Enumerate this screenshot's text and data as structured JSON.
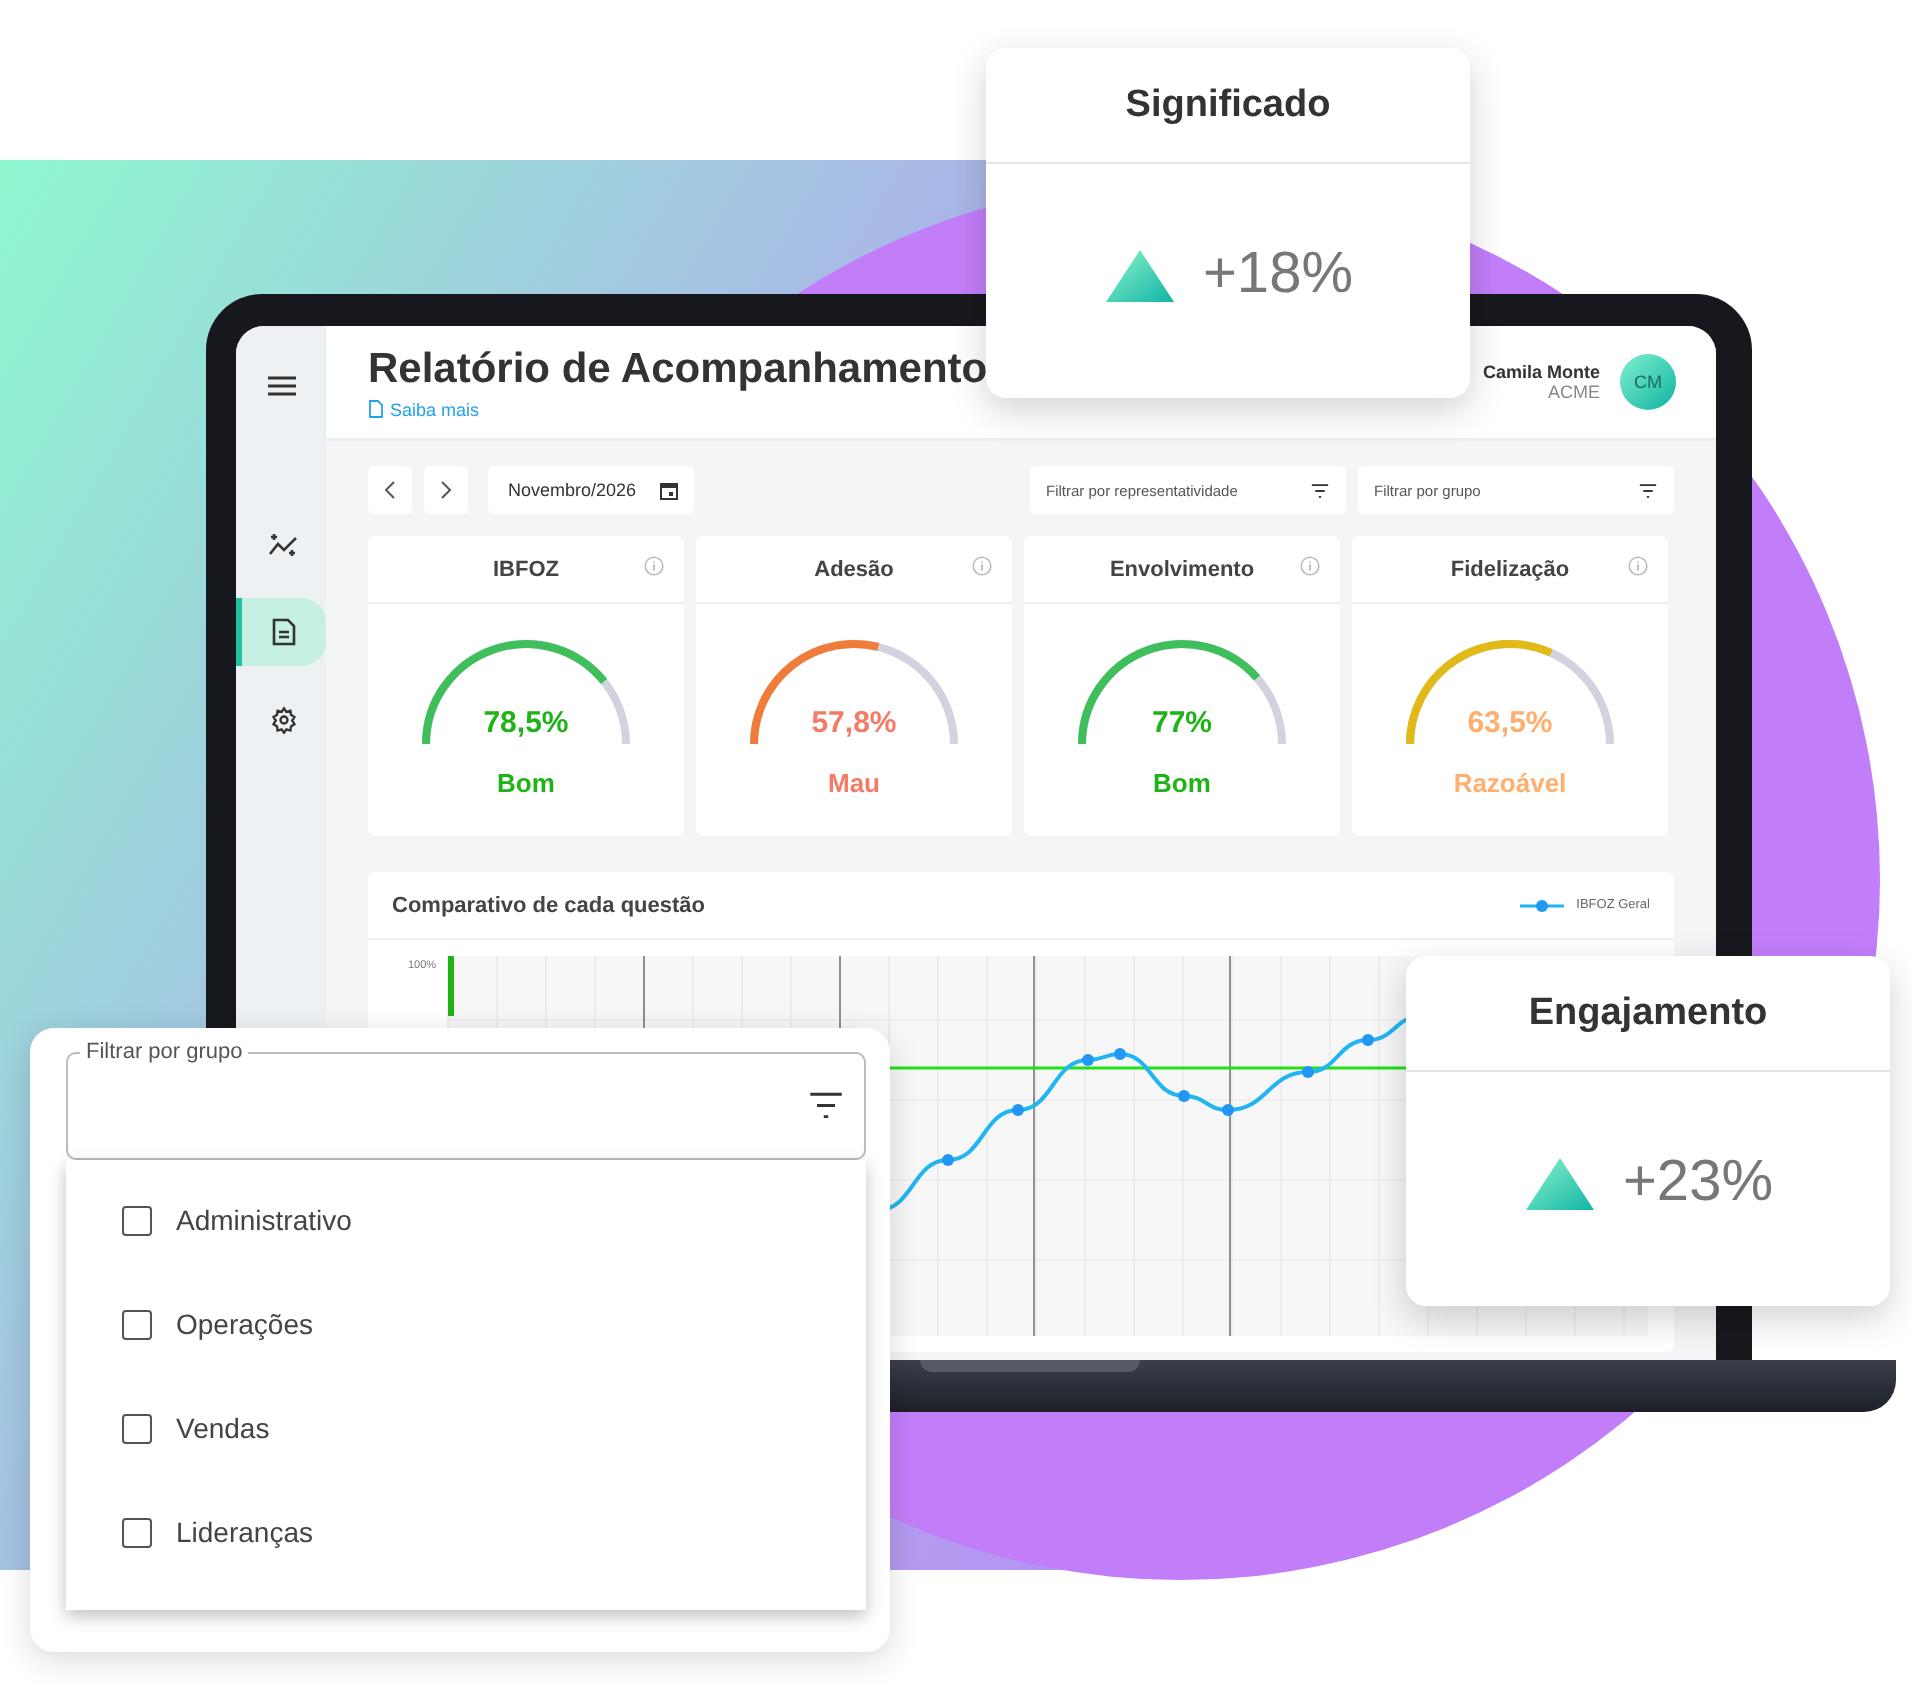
{
  "floating_cards": [
    {
      "title": "Significado",
      "change": "+18%"
    },
    {
      "title": "Engajamento",
      "change": "+23%"
    }
  ],
  "sidebar": {
    "items": [
      {
        "kind": "insights",
        "selected": false
      },
      {
        "kind": "report",
        "selected": true
      },
      {
        "kind": "settings",
        "selected": false
      }
    ]
  },
  "header": {
    "title": "Relatório de Acompanhamento",
    "link": "Saiba mais",
    "user": {
      "name": "Camila Monte",
      "company": "ACME",
      "initials": "CM"
    }
  },
  "toolbar": {
    "period": "Novembro/2026",
    "filters": [
      "Filtrar por representatividade",
      "Filtrar por grupo"
    ]
  },
  "metrics": [
    {
      "title": "IBFOZ",
      "value": "78,5%",
      "rating": {
        "text": "Bom",
        "color": "#1fb317"
      },
      "level": 0.785,
      "color": "#3fbf5c"
    },
    {
      "title": "Adesão",
      "value": "57,8%",
      "rating": {
        "text": "Mau",
        "color": "#f47c66"
      },
      "level": 0.578,
      "color": "#f07c3a"
    },
    {
      "title": "Envolvimento",
      "value": "77%",
      "rating": {
        "text": "Bom",
        "color": "#1fb317"
      },
      "level": 0.77,
      "color": "#3fbf5c"
    },
    {
      "title": "Fidelização",
      "value": "63,5%",
      "rating": {
        "text": "Razoável",
        "color": "#ffae6e"
      },
      "level": 0.635,
      "color": "#e2ba18"
    }
  ],
  "chart": {
    "title": "Comparativo de cada questão",
    "legend": "IBFOZ Geral",
    "y_tick": "100%"
  },
  "group_filter": {
    "label": "Filtrar por grupo",
    "options": [
      {
        "label": "Administrativo",
        "checked": false
      },
      {
        "label": "Operações",
        "checked": false
      },
      {
        "label": "Vendas",
        "checked": false
      },
      {
        "label": "Lideranças",
        "checked": false
      }
    ]
  }
}
